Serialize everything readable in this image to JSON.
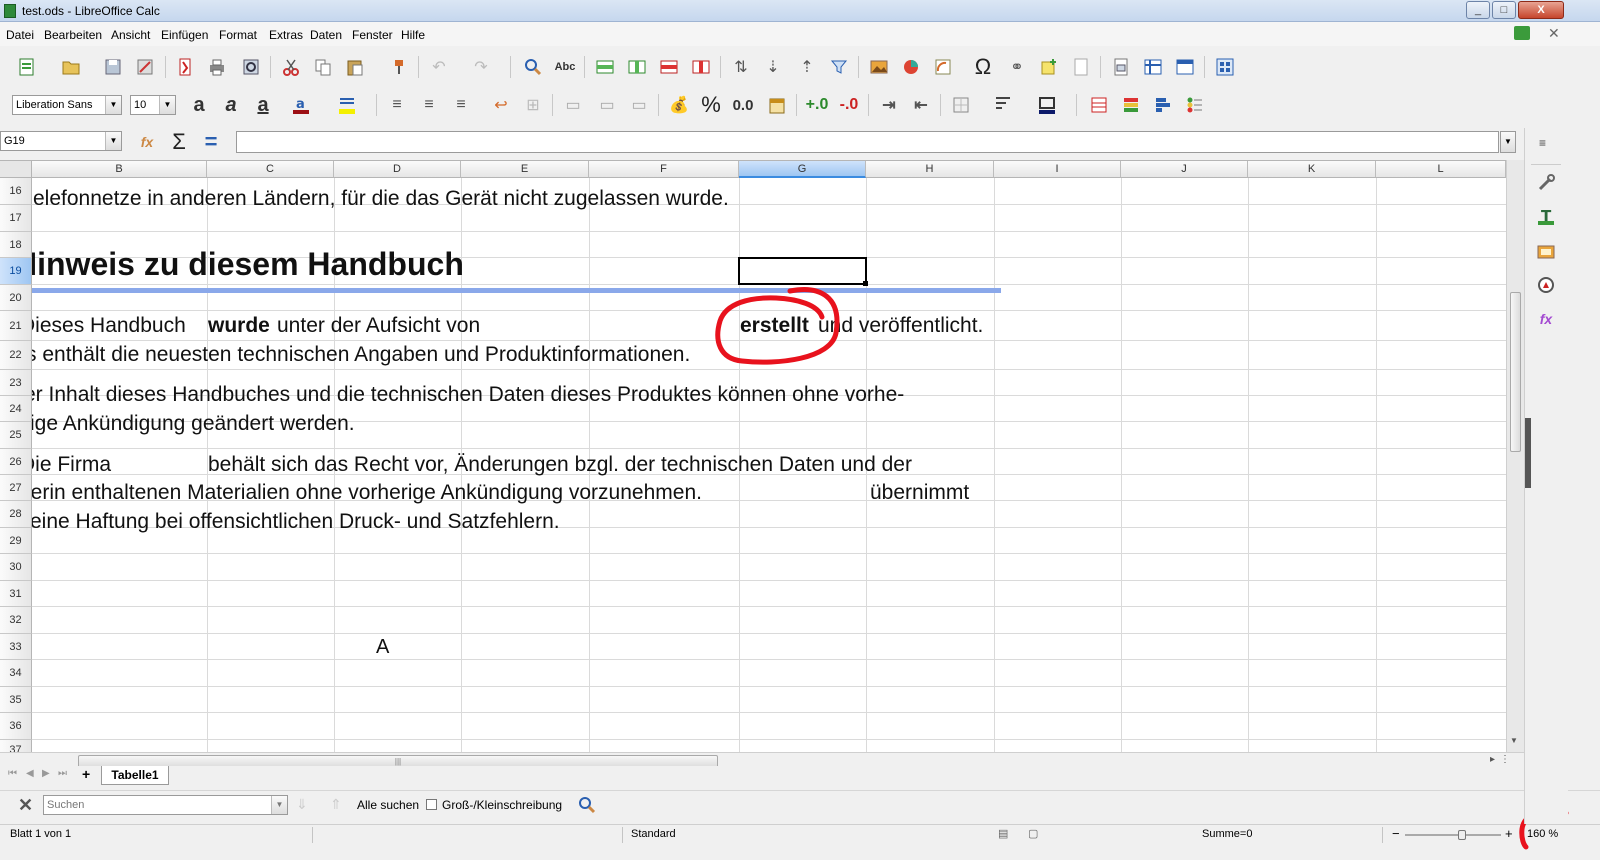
{
  "window": {
    "title": "test.ods - LibreOffice Calc",
    "min_label": "_",
    "max_label": "□",
    "close_label": "X"
  },
  "menu": [
    "Datei",
    "Bearbeiten",
    "Ansicht",
    "Einfügen",
    "Format",
    "Extras",
    "Daten",
    "Fenster",
    "Hilfe"
  ],
  "format_bar": {
    "font_name": "Liberation Sans",
    "font_size": "10",
    "percent_label": "%",
    "decimal_label": "0.0"
  },
  "formula_bar": {
    "name_box": "G19",
    "sum_symbol": "Σ",
    "equals_symbol": "=",
    "formula_value": ""
  },
  "columns": [
    "B",
    "C",
    "D",
    "E",
    "F",
    "G",
    "H",
    "I",
    "J",
    "K",
    "L"
  ],
  "selected_column": "G",
  "rows": [
    "16",
    "17",
    "18",
    "19",
    "20",
    "21",
    "22",
    "23",
    "24",
    "25",
    "26",
    "27",
    "28",
    "29",
    "30",
    "31",
    "32",
    "33",
    "34",
    "35",
    "36",
    "37"
  ],
  "selected_row": "19",
  "content": {
    "line_16": "elefonnetze in anderen Ländern, für die das Gerät nicht zugelassen wurde.",
    "heading": "Hinweis zu diesem Handbuch",
    "line_21a": "Dieses Handbuch",
    "line_21b": "wurde",
    "line_21c": "unter der Aufsicht von",
    "line_21d": "erstellt",
    "line_21e": "und veröffentlicht.",
    "line_22": "s enthält die neuesten technischen Angaben und Produktinformationen.",
    "line_23": "er Inhalt dieses Handbuches und die technischen Daten dieses Produktes können ohne vorhe-",
    "line_24": "ige Ankündigung geändert werden.",
    "line_26a": "Die Firma",
    "line_26b": "behält sich das Recht vor, Änderungen bzgl. der technischen Daten und der",
    "line_27a": "ierin enthaltenen Materialien ohne vorherige Ankündigung vorzunehmen.",
    "line_27b": "übernimmt",
    "line_28": "eine Haftung bei offensichtlichen Druck- und Satzfehlern.",
    "cell_d33": "A"
  },
  "hscroll_grip": "|||",
  "sheet_tabs": {
    "add_label": "+",
    "active": "Tabelle1"
  },
  "find_bar": {
    "placeholder": "Suchen",
    "find_all": "Alle suchen",
    "match_case": "Groß-/Kleinschreibung"
  },
  "status_bar": {
    "sheet": "Blatt 1 von 1",
    "page_style": "Standard",
    "sum": "Summe=0",
    "zoom_minus": "−",
    "zoom_plus": "+",
    "zoom": "160 %"
  },
  "colors": {
    "annotation_red": "#e8121d",
    "selection_blue": "#3a8be0",
    "heading_rule": "#8aa8ea"
  }
}
